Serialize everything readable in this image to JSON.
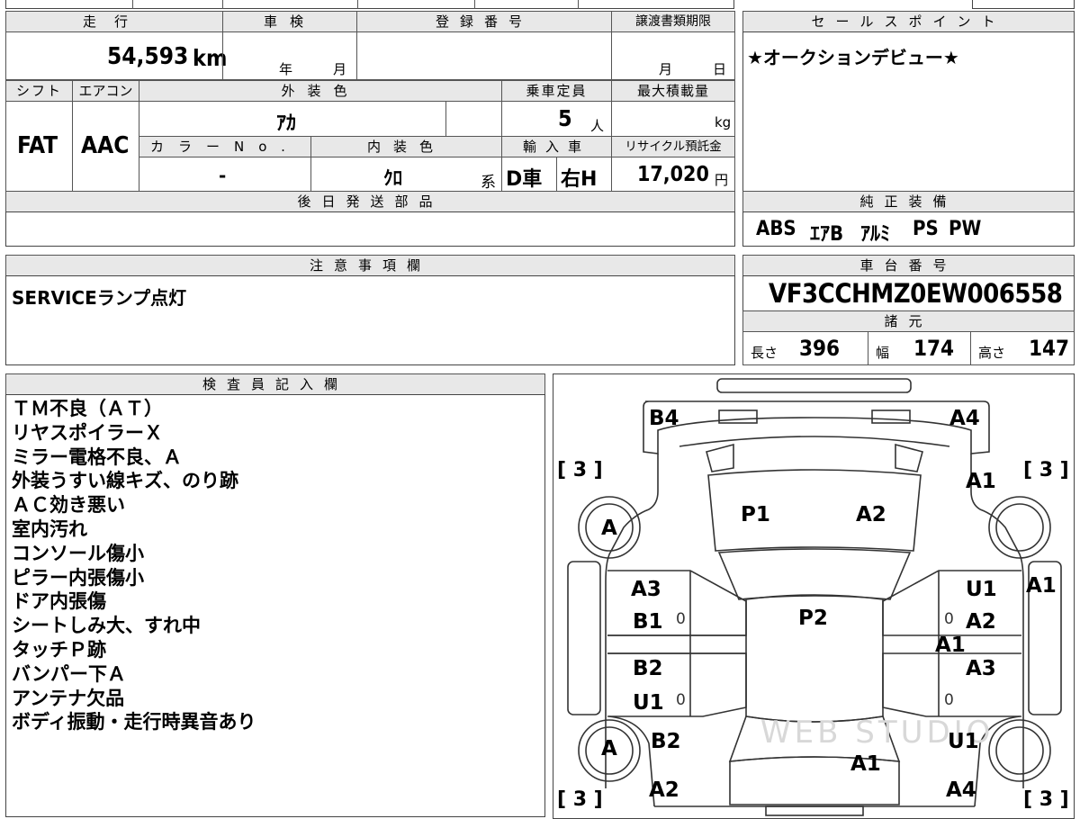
{
  "mileage": {
    "header": "走行",
    "value": "54,593",
    "unit": "km"
  },
  "inspection": {
    "header": "車検",
    "year": "年",
    "month": "月"
  },
  "registration": {
    "header": "登録番号",
    "value": ""
  },
  "transfer_deadline": {
    "header": "譲渡書類期限",
    "month": "月",
    "day": "日"
  },
  "sales_point": {
    "header": "セールスポイント",
    "text": "★オークションデビュー★"
  },
  "shift": {
    "header": "シフト",
    "value": "FAT"
  },
  "aircon": {
    "header": "エアコン",
    "value": "AAC"
  },
  "exterior_color": {
    "header": "外装色",
    "value": "ｱｶ"
  },
  "capacity": {
    "header": "乗車定員",
    "value": "5",
    "unit": "人"
  },
  "max_load": {
    "header": "最大積載量",
    "unit": "kg"
  },
  "color_no": {
    "header": "カラーNo.",
    "value": "-"
  },
  "interior_color": {
    "header": "内装色",
    "value": "ｸﾛ",
    "suffix": "系"
  },
  "import": {
    "header": "輸入車",
    "type": "D車",
    "steering": "右H"
  },
  "recycle": {
    "header": "リサイクル預託金",
    "value": "17,020",
    "unit": "円"
  },
  "later_parts": {
    "header": "後日発送部品",
    "value": ""
  },
  "equipment": {
    "header": "純正装備",
    "items": [
      "ABS",
      "ｴｱB",
      "ｱﾙﾐ",
      "PS",
      "PW"
    ]
  },
  "notes": {
    "header": "注意事項欄",
    "text": "SERVICEランプ点灯"
  },
  "chassis": {
    "header": "車台番号",
    "value": "VF3CCHMZ0EW006558"
  },
  "specs": {
    "header": "諸元",
    "length": {
      "label": "長さ",
      "value": "396"
    },
    "width": {
      "label": "幅",
      "value": "174"
    },
    "height": {
      "label": "高さ",
      "value": "147"
    }
  },
  "inspector": {
    "header": "検査員記入欄",
    "lines": [
      "ＴＭ不良（ＡＴ）",
      "リヤスポイラーＸ",
      "ミラー電格不良、Ａ",
      "外装うすい線キズ、のり跡",
      "ＡＣ効き悪い",
      "室内汚れ",
      "コンソール傷小",
      "ピラー内張傷小",
      "ドア内張傷",
      "シートしみ大、すれ中",
      "タッチＰ跡",
      "バンパー下Ａ",
      "アンテナ欠品",
      "ボディ振動・走行時異音あり"
    ]
  },
  "diagram": {
    "tires": {
      "front_left": "[ 3 ]",
      "front_right": "[ 3 ]",
      "rear_left": "[ 3 ]",
      "rear_right": "[ 3 ]"
    },
    "wheels": {
      "front_left": "A",
      "rear_left": "A"
    },
    "codes": {
      "front_bumper_left": "B4",
      "front_bumper_right": "A4",
      "hood_left": "P1",
      "hood_right": "A2",
      "fender_right": "A1",
      "quarter_right_outer": "A1",
      "front_door_left_a": "A3",
      "front_door_left_b": "B1",
      "front_door_right_a": "U1",
      "front_door_right_b": "A2",
      "roof": "P2",
      "pillar_right": "A1",
      "rear_door_left_a": "B2",
      "rear_door_left_b": "U1",
      "rear_door_right": "A3",
      "quarter_left": "B2",
      "quarter_right": "U1",
      "trunk": "A1",
      "rear_bumper_left": "A2",
      "rear_bumper_right": "A4",
      "zero": "0"
    },
    "watermark": "WEB STUDIO"
  }
}
